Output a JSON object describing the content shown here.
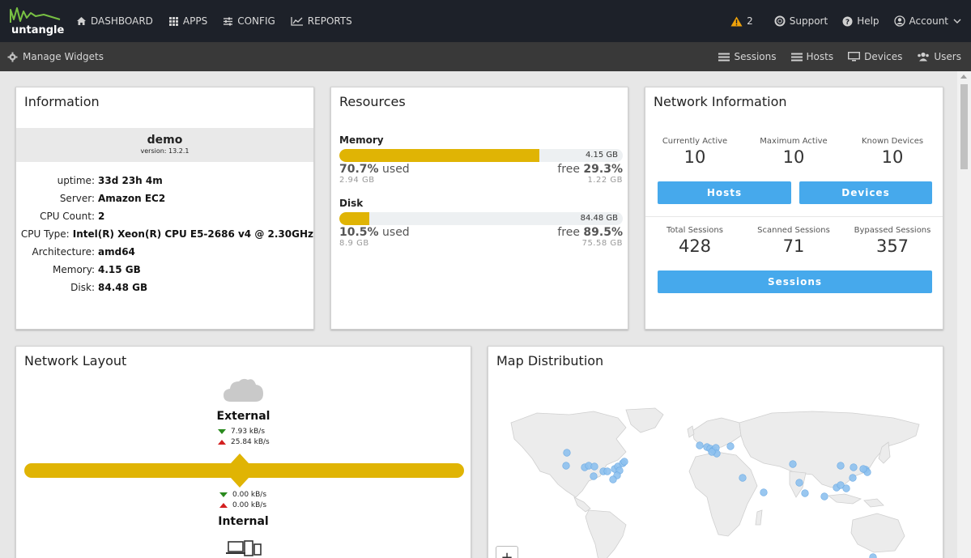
{
  "brand": {
    "name": "untangle",
    "accent": "#78c043"
  },
  "topnav": {
    "left": [
      {
        "label": "DASHBOARD",
        "icon": "home-icon"
      },
      {
        "label": "APPS",
        "icon": "grid-icon"
      },
      {
        "label": "CONFIG",
        "icon": "sliders-icon"
      },
      {
        "label": "REPORTS",
        "icon": "chart-line-icon"
      }
    ],
    "alerts_count": "2",
    "right": [
      {
        "label": "Support",
        "icon": "lifebuoy-icon"
      },
      {
        "label": "Help",
        "icon": "question-icon"
      },
      {
        "label": "Account",
        "icon": "user-circle-icon"
      }
    ]
  },
  "subbar": {
    "manage_label": "Manage Widgets",
    "links": [
      {
        "label": "Sessions",
        "icon": "list-icon"
      },
      {
        "label": "Hosts",
        "icon": "list-icon"
      },
      {
        "label": "Devices",
        "icon": "monitor-icon"
      },
      {
        "label": "Users",
        "icon": "users-icon"
      }
    ]
  },
  "information": {
    "title": "Information",
    "server_name": "demo",
    "version": "version: 13.2.1",
    "rows": [
      {
        "label": "uptime:",
        "value": "33d 23h 4m"
      },
      {
        "label": "Server:",
        "value": "Amazon EC2"
      },
      {
        "label": "CPU Count:",
        "value": "2"
      },
      {
        "label": "CPU Type:",
        "value": "Intel(R) Xeon(R) CPU E5-2686 v4 @ 2.30GHz"
      },
      {
        "label": "Architecture:",
        "value": "amd64"
      },
      {
        "label": "Memory:",
        "value": "4.15 GB"
      },
      {
        "label": "Disk:",
        "value": "84.48 GB"
      }
    ]
  },
  "resources": {
    "title": "Resources",
    "memory": {
      "label": "Memory",
      "total": "4.15 GB",
      "used_pct": "70.7%",
      "used_word": "used",
      "free_word": "free",
      "free_pct": "29.3%",
      "used_amount": "2.94 GB",
      "free_amount": "1.22 GB",
      "fill_fraction": 0.707
    },
    "disk": {
      "label": "Disk",
      "total": "84.48 GB",
      "used_pct": "10.5%",
      "used_word": "used",
      "free_word": "free",
      "free_pct": "89.5%",
      "used_amount": "8.9 GB",
      "free_amount": "75.58 GB",
      "fill_fraction": 0.105
    },
    "bar_color": "#e0b404"
  },
  "network_info": {
    "title": "Network Information",
    "top_stats": [
      {
        "label": "Currently Active",
        "value": "10"
      },
      {
        "label": "Maximum Active",
        "value": "10"
      },
      {
        "label": "Known Devices",
        "value": "10"
      }
    ],
    "hosts_button": "Hosts",
    "devices_button": "Devices",
    "bottom_stats": [
      {
        "label": "Total Sessions",
        "value": "428"
      },
      {
        "label": "Scanned Sessions",
        "value": "71"
      },
      {
        "label": "Bypassed Sessions",
        "value": "357"
      }
    ],
    "sessions_button": "Sessions",
    "button_color": "#46a9ec"
  },
  "network_layout": {
    "title": "Network Layout",
    "external_label": "External",
    "external_down": "7.93 kB/s",
    "external_up": "25.84 kB/s",
    "internal_down": "0.00 kB/s",
    "internal_up": "0.00 kB/s",
    "internal_label": "Internal",
    "cloud_icon": "cloud-icon",
    "devices_icon": "devices-icon"
  },
  "map": {
    "title": "Map Distribution",
    "zoom_in_label": "+",
    "marker_color": "#8ec1ee"
  }
}
